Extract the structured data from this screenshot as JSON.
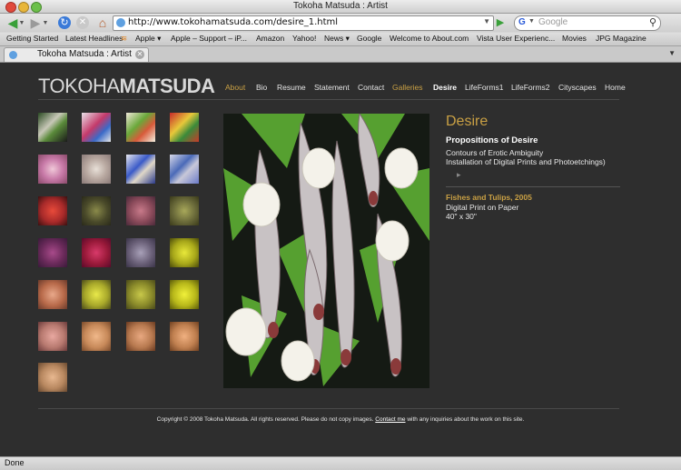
{
  "window": {
    "title": "Tokoha Matsuda : Artist"
  },
  "toolbar": {
    "url": "http://www.tokohamatsuda.com/desire_1.html",
    "search_placeholder": "Google",
    "search_engine": "G"
  },
  "bookmarks": [
    "Getting Started",
    "Latest Headlines",
    "Apple ▾",
    "Apple – Support – iP...",
    "Amazon",
    "Yahoo!",
    "News ▾",
    "Google",
    "Welcome to About.com",
    "Vista User Experienc...",
    "Movies",
    "JPG Magazine"
  ],
  "tab": {
    "label": "Tokoha Matsuda : Artist"
  },
  "site": {
    "logo_first": "TOKOHA",
    "logo_last": "MATSUDA",
    "nav": [
      "About",
      "Bio",
      "Resume",
      "Statement",
      "Contact",
      "Galleries",
      "Desire",
      "LifeForms1",
      "LifeForms2",
      "Cityscapes",
      "Home"
    ]
  },
  "gallery": {
    "title": "Desire",
    "subtitle": "Propositions of Desire",
    "line1": "Contours of Erotic Ambiguity",
    "line2": "Installation of Digital Prints and Photoetchings)",
    "arrow": "▸",
    "work_title": "Fishes and Tulips, 2005",
    "work_medium": "Digital Print on Paper",
    "work_size": "40\" x 30\""
  },
  "footer": {
    "text_before": "Copyright © 2008 Tokoha Matsuda. All rights reserved. Please do not copy images.",
    "link": "Contact me",
    "text_after": "with any inquiries about the work on this site."
  },
  "status": {
    "text": "Done"
  },
  "colors": {
    "accent": "#c9a044",
    "page_bg": "#2e2e2e"
  }
}
